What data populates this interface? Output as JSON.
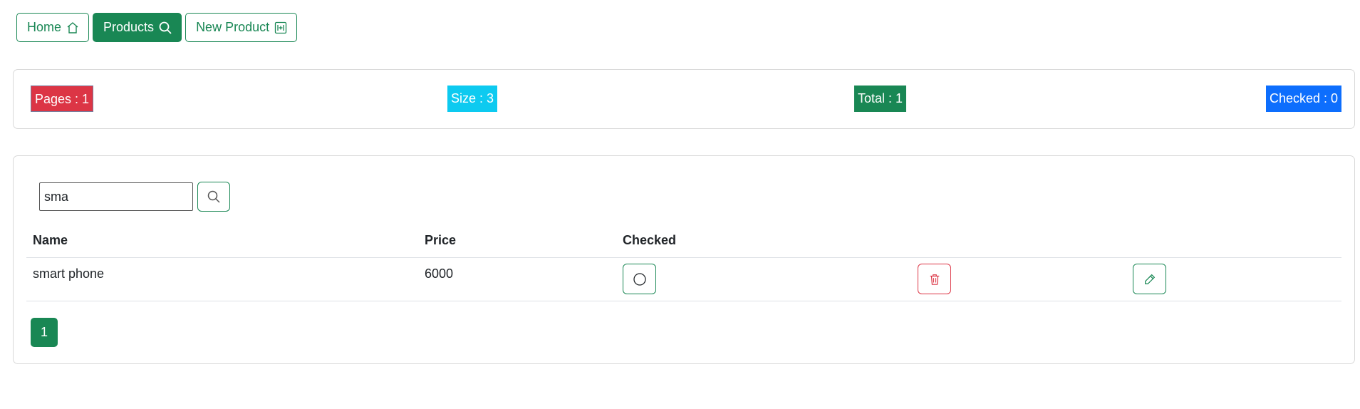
{
  "nav": {
    "home_label": "Home",
    "products_label": "Products",
    "new_product_label": "New Product"
  },
  "stats": {
    "pages": "Pages : 1",
    "size": "Size : 3",
    "total": "Total : 1",
    "checked": "Checked : 0"
  },
  "search": {
    "value": "sma"
  },
  "table": {
    "headers": [
      "Name",
      "Price",
      "Checked"
    ],
    "rows": [
      {
        "name": "smart phone",
        "price": "6000"
      }
    ]
  },
  "pagination": {
    "pages": [
      "1"
    ]
  },
  "colors": {
    "primary_green": "#198754",
    "danger": "#dc3545",
    "info": "#0dcaf0",
    "primary_blue": "#0d6efd"
  },
  "icons": {
    "home": "house-icon",
    "products": "search-icon",
    "new_product": "add-box-icon",
    "check": "circle-icon",
    "delete": "trash-icon",
    "edit": "pencil-icon"
  }
}
